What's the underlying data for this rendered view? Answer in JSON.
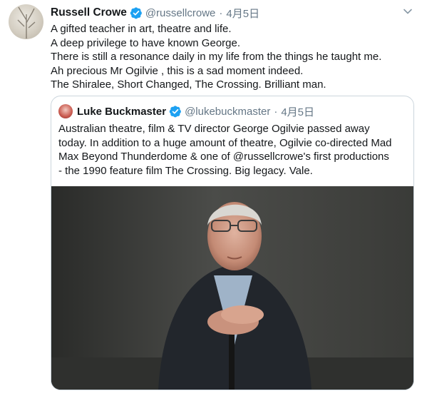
{
  "tweet": {
    "author_name": "Russell Crowe",
    "author_handle": "@russellcrowe",
    "separator": "·",
    "date": "4月5日",
    "lines": [
      "A gifted teacher in art, theatre and life.",
      "A deep privilege to have known George.",
      "There is still a resonance daily in my life from the things he taught me.",
      "Ah precious Mr Ogilvie , this is a sad moment indeed.",
      "The Shiralee, Short Changed, The Crossing. Brilliant man."
    ]
  },
  "quoted": {
    "author_name": "Luke Buckmaster",
    "author_handle": "@lukebuckmaster",
    "separator": "·",
    "date": "4月5日",
    "lines": [
      "Australian theatre, film & TV director George Ogilvie passed away",
      "today. In addition to a huge amount of theatre, Ogilvie co-directed Mad",
      "Max Beyond Thunderdome & one of @russellcrowe's first productions",
      "- the 1990 feature film The Crossing. Big legacy. Vale."
    ]
  },
  "icons": {
    "verified": "verified-badge-icon",
    "more": "chevron-down-icon"
  },
  "colors": {
    "verified_blue": "#1da1f2",
    "secondary_text": "#657786",
    "border": "#ccd6dd"
  }
}
